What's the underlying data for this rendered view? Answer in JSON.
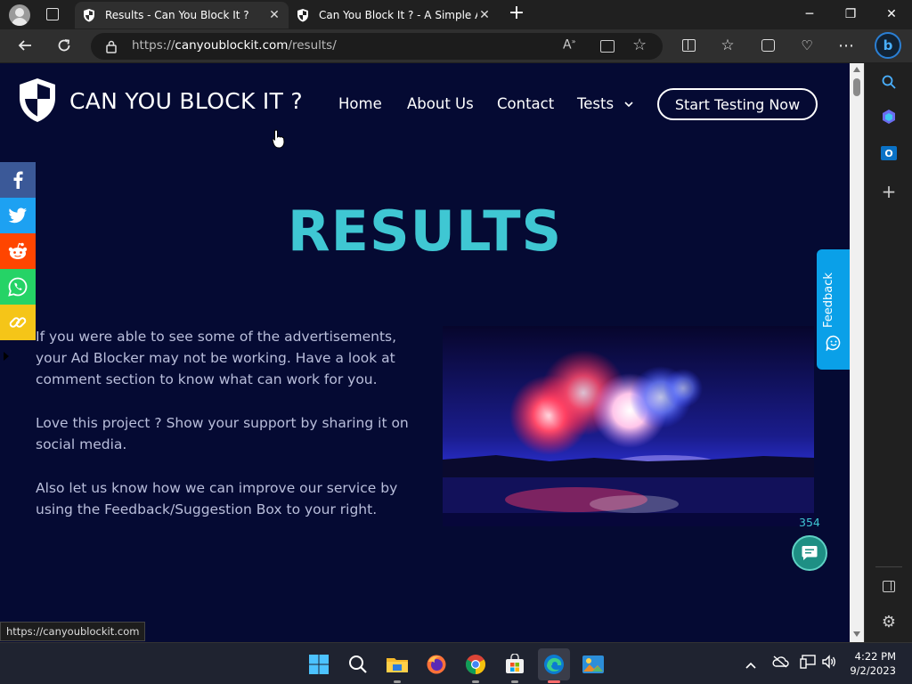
{
  "browser": {
    "tabs": [
      {
        "title": "Results - Can You Block It ?",
        "active": true
      },
      {
        "title": "Can You Block It ? - A Simple Ad",
        "active": false
      }
    ],
    "new_tab_label": "+",
    "window_controls": {
      "minimize": "─",
      "restore": "❐",
      "close": "✕"
    },
    "url_scheme": "https://",
    "url_domain": "canyoublockit.com",
    "url_path": "/results/",
    "status_url": "https://canyoublockit.com"
  },
  "site": {
    "logo_text": "CAN YOU BLOCK IT ?",
    "nav": {
      "home": "Home",
      "about": "About Us",
      "contact": "Contact",
      "tests": "Tests"
    },
    "cta": "Start Testing Now",
    "heading": "RESULTS",
    "paragraphs": [
      "If you were able to see some of the advertisements, your Ad Blocker may not be working. Have a look at comment section to know what can work for you.",
      "Love this project ? Show your support by sharing it on social media.",
      "Also let us know how we can improve our service by using the Feedback/Suggestion Box to your right."
    ],
    "counter": "354",
    "feedback_label": "Feedback",
    "share_colors": {
      "facebook": "#3b5998",
      "twitter": "#1da1f2",
      "reddit": "#ff4500",
      "whatsapp": "#25d366",
      "link": "#f5c518"
    }
  },
  "taskbar": {
    "time": "4:22 PM",
    "date": "9/2/2023"
  }
}
